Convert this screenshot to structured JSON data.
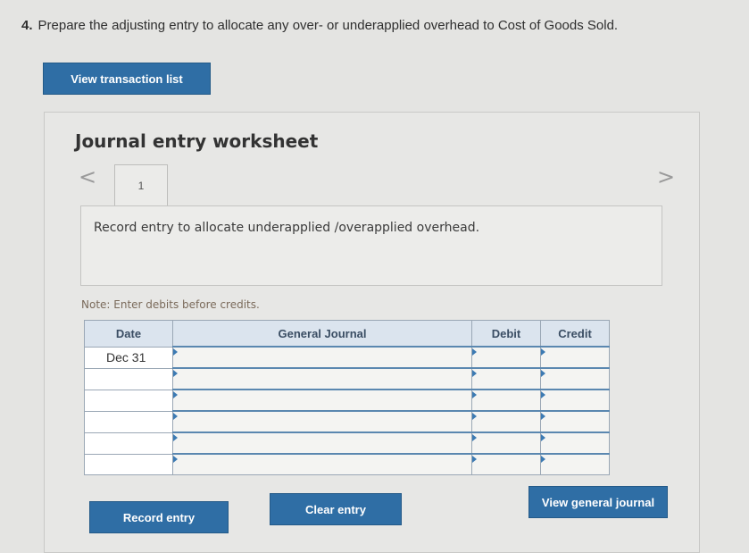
{
  "question": {
    "number": "4.",
    "text": "Prepare the adjusting entry to allocate any over- or underapplied overhead to Cost of Goods Sold."
  },
  "buttons": {
    "view_transaction_list": "View transaction list",
    "record_entry": "Record entry",
    "clear_entry": "Clear entry",
    "view_general_journal": "View general journal"
  },
  "worksheet": {
    "title": "Journal entry worksheet",
    "prev_arrow": "<",
    "next_arrow": ">",
    "tab_label": "1",
    "instruction": "Record entry to allocate underapplied /overapplied overhead.",
    "note": "Note: Enter debits before credits."
  },
  "journal": {
    "headers": {
      "date": "Date",
      "general_journal": "General Journal",
      "debit": "Debit",
      "credit": "Credit"
    },
    "rows": [
      {
        "date": "Dec 31"
      },
      {
        "date": ""
      },
      {
        "date": ""
      },
      {
        "date": ""
      },
      {
        "date": ""
      },
      {
        "date": ""
      }
    ]
  },
  "colors": {
    "button": "#2f6ea5",
    "header_bg": "#dbe4ee",
    "input_marker": "#3c7ab3"
  }
}
